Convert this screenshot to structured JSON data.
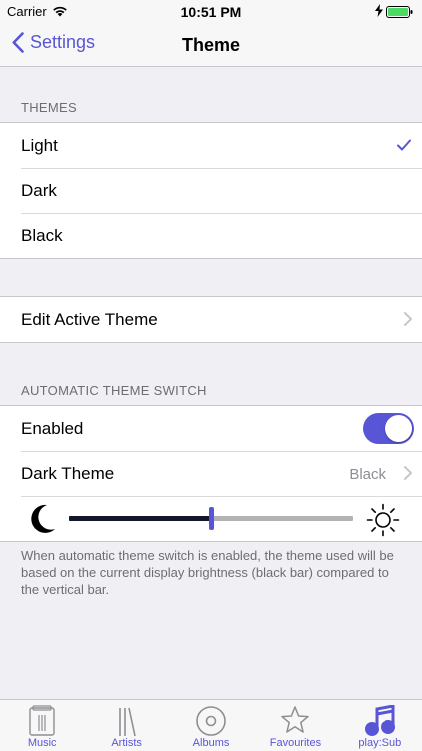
{
  "status": {
    "carrier": "Carrier",
    "time": "10:51 PM"
  },
  "nav": {
    "back_label": "Settings",
    "title": "Theme"
  },
  "themes": {
    "header": "THEMES",
    "items": [
      {
        "label": "Light",
        "selected": true
      },
      {
        "label": "Dark",
        "selected": false
      },
      {
        "label": "Black",
        "selected": false
      }
    ]
  },
  "edit": {
    "label": "Edit Active Theme"
  },
  "auto": {
    "header": "AUTOMATIC THEME SWITCH",
    "enabled_label": "Enabled",
    "enabled": true,
    "dark_theme_label": "Dark Theme",
    "dark_theme_value": "Black",
    "brightness_threshold": 0.5
  },
  "footer": "When automatic theme switch is enabled, the theme used will be based on the current display brightness (black bar) compared to the vertical bar.",
  "tabs": [
    {
      "label": "Music",
      "icon": "music-library-icon"
    },
    {
      "label": "Artists",
      "icon": "artists-icon"
    },
    {
      "label": "Albums",
      "icon": "album-disc-icon"
    },
    {
      "label": "Favourites",
      "icon": "star-icon"
    },
    {
      "label": "play:Sub",
      "icon": "playsub-logo-icon"
    }
  ],
  "colors": {
    "accent": "#5856d6",
    "background": "#efeff4",
    "separator": "#c8c7cc"
  }
}
